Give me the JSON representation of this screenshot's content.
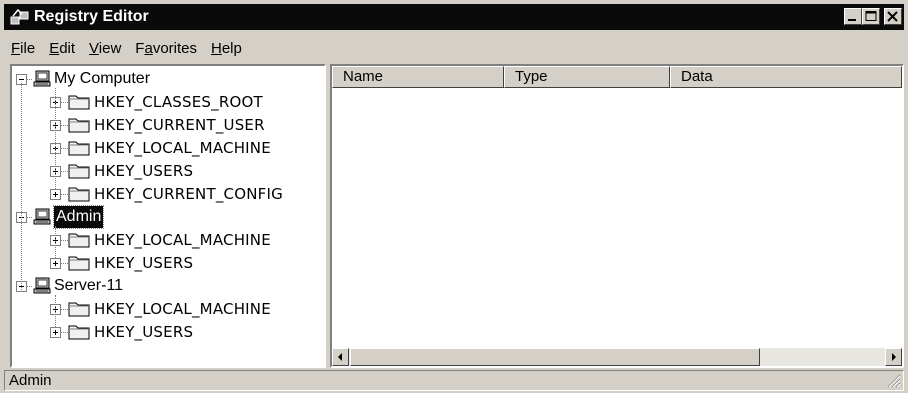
{
  "window": {
    "title": "Registry Editor"
  },
  "menu": [
    {
      "label": "File",
      "accel": "F"
    },
    {
      "label": "Edit",
      "accel": "E"
    },
    {
      "label": "View",
      "accel": "V"
    },
    {
      "label": "Favorites",
      "accel": "a"
    },
    {
      "label": "Help",
      "accel": "H"
    }
  ],
  "tree": {
    "computers": [
      {
        "name": "My Computer",
        "expanded": true,
        "selected": false,
        "keys": [
          "HKEY_CLASSES_ROOT",
          "HKEY_CURRENT_USER",
          "HKEY_LOCAL_MACHINE",
          "HKEY_USERS",
          "HKEY_CURRENT_CONFIG"
        ]
      },
      {
        "name": "Admin",
        "expanded": true,
        "selected": true,
        "keys": [
          "HKEY_LOCAL_MACHINE",
          "HKEY_USERS"
        ]
      },
      {
        "name": "Server-11",
        "expanded": true,
        "selected": false,
        "keys": [
          "HKEY_LOCAL_MACHINE",
          "HKEY_USERS"
        ]
      }
    ]
  },
  "list": {
    "columns": [
      "Name",
      "Type",
      "Data"
    ],
    "rows": []
  },
  "status": {
    "text": "Admin"
  },
  "icons": {
    "app": "registry-editor-icon",
    "computer": "computer-icon",
    "folder": "folder-icon"
  }
}
